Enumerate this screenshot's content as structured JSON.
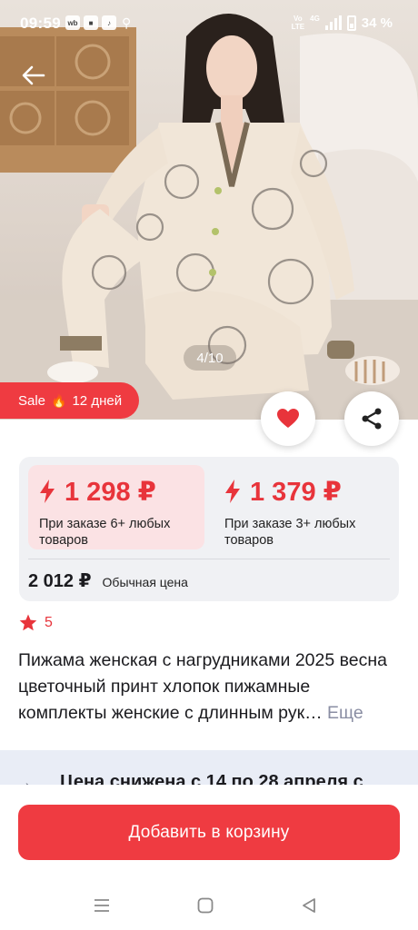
{
  "status_bar": {
    "time": "09:59",
    "app_icons": [
      "wb-icon",
      "app-icon",
      "tiktok-icon"
    ],
    "network_volte": "Vo\nLTE",
    "network_type": "4G",
    "battery": "34 %"
  },
  "gallery": {
    "counter": "4/10",
    "sale_label": "Sale",
    "sale_days": "12 дней"
  },
  "prices": {
    "option1_amount": "1 298 ₽",
    "option1_condition": "При заказе 6+ любых товаров",
    "option2_amount": "1 379 ₽",
    "option2_condition": "При заказе 3+ любых товаров",
    "regular_amount": "2 012 ₽",
    "regular_label": "Обычная цена"
  },
  "rating": {
    "value": "5"
  },
  "product": {
    "title": "Пижама женская с нагрудниками 2025 весна цветочный принт хлопок пижамные комплекты женские с длинным рук…",
    "more_label": "Еще"
  },
  "promo": {
    "text": "Цена снижена с 14 по 28 апреля с"
  },
  "actions": {
    "add_to_cart": "Добавить в корзину"
  },
  "colors": {
    "accent": "#ef3b41",
    "price_red": "#e8343b",
    "card_bg": "#f0f1f4",
    "highlight_bg": "#fbe2e4"
  }
}
